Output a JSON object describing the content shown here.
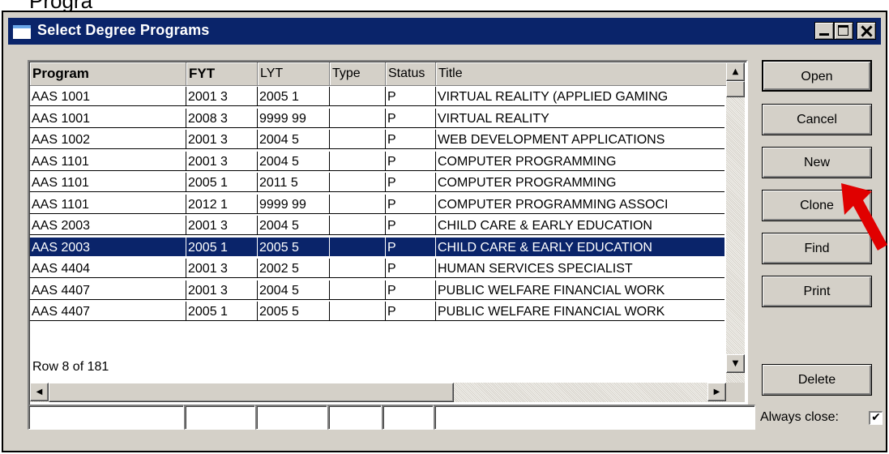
{
  "cutoff_text": "Progra",
  "window": {
    "title": "Select Degree Programs"
  },
  "colors": {
    "titlebar": "#0a246a",
    "selection": "#0a246a",
    "face": "#d4d0c8",
    "arrow": "#e00000"
  },
  "icons": [
    "window-icon",
    "minimize-icon",
    "maximize-icon",
    "close-icon",
    "scroll-up-icon",
    "scroll-down-icon",
    "scroll-left-icon",
    "scroll-right-icon",
    "checkmark-icon",
    "red-arrow-annotation"
  ],
  "table": {
    "columns": [
      "Program",
      "FYT",
      "LYT",
      "Type",
      "Status",
      "Title"
    ],
    "rows": [
      [
        "AAS 1001",
        "2001 3",
        "2005 1",
        "",
        "P",
        "VIRTUAL REALITY (APPLIED GAMING"
      ],
      [
        "AAS 1001",
        "2008 3",
        "9999 99",
        "",
        "P",
        "VIRTUAL REALITY"
      ],
      [
        "AAS 1002",
        "2001 3",
        "2004 5",
        "",
        "P",
        "WEB DEVELOPMENT APPLICATIONS"
      ],
      [
        "AAS 1101",
        "2001 3",
        "2004 5",
        "",
        "P",
        "COMPUTER PROGRAMMING"
      ],
      [
        "AAS 1101",
        "2005 1",
        "2011 5",
        "",
        "P",
        "COMPUTER PROGRAMMING"
      ],
      [
        "AAS 1101",
        "2012 1",
        "9999 99",
        "",
        "P",
        "COMPUTER PROGRAMMING ASSOCI"
      ],
      [
        "AAS 2003",
        "2001 3",
        "2004 5",
        "",
        "P",
        "CHILD CARE & EARLY EDUCATION"
      ],
      [
        "AAS 2003",
        "2005 1",
        "2005 5",
        "",
        "P",
        "CHILD CARE & EARLY EDUCATION"
      ],
      [
        "AAS 4404",
        "2001 3",
        "2002 5",
        "",
        "P",
        "HUMAN SERVICES SPECIALIST"
      ],
      [
        "AAS 4407",
        "2001 3",
        "2004 5",
        "",
        "P",
        "PUBLIC WELFARE FINANCIAL WORK"
      ],
      [
        "AAS 4407",
        "2005 1",
        "2005 5",
        "",
        "P",
        "PUBLIC WELFARE FINANCIAL WORK"
      ]
    ],
    "selected_row": 8,
    "row_count_text": "Row 8 of 181"
  },
  "buttons": {
    "open": "Open",
    "cancel": "Cancel",
    "new": "New",
    "clone": "Clone",
    "find": "Find",
    "print": "Print",
    "delete": "Delete"
  },
  "filter_fields": {
    "program": "",
    "fyt": "",
    "lyt": "",
    "type": "",
    "status": "",
    "title": ""
  },
  "always_close": {
    "label": "Always close:",
    "checked": true,
    "mark": "✔"
  }
}
